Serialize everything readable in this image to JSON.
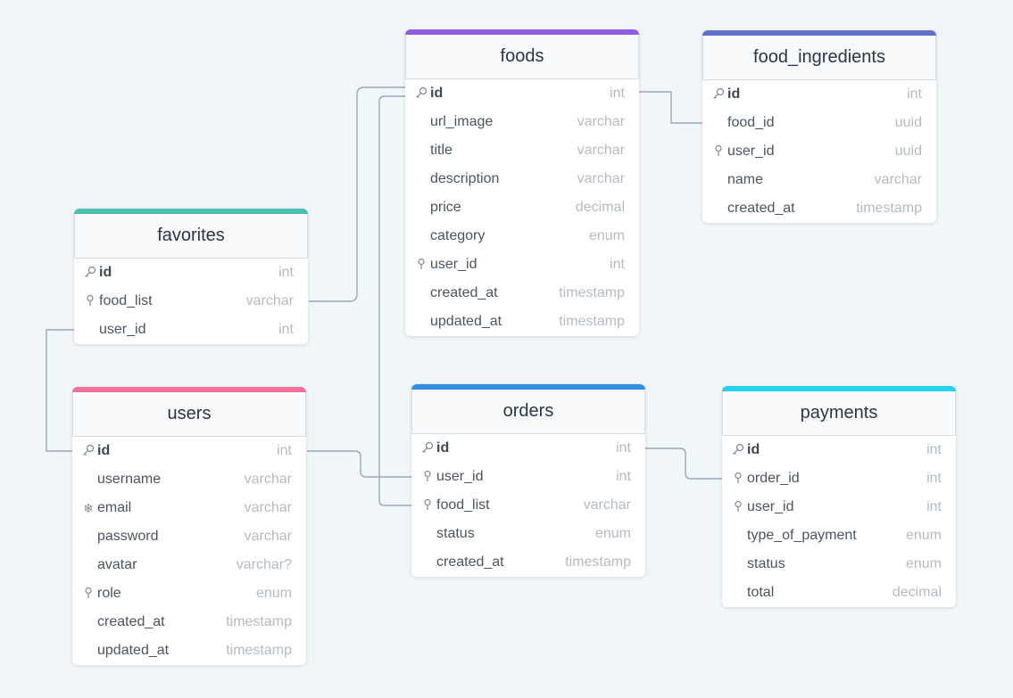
{
  "tables": [
    {
      "name": "foods",
      "color": "#8e5ee0",
      "fields": [
        {
          "name": "id",
          "type": "int",
          "icon": "key-icon",
          "pk": true
        },
        {
          "name": "url_image",
          "type": "varchar",
          "icon": ""
        },
        {
          "name": "title",
          "type": "varchar",
          "icon": ""
        },
        {
          "name": "description",
          "type": "varchar",
          "icon": ""
        },
        {
          "name": "price",
          "type": "decimal",
          "icon": ""
        },
        {
          "name": "category",
          "type": "enum",
          "icon": ""
        },
        {
          "name": "user_id",
          "type": "int",
          "icon": "index-pin-icon"
        },
        {
          "name": "created_at",
          "type": "timestamp",
          "icon": ""
        },
        {
          "name": "updated_at",
          "type": "timestamp",
          "icon": ""
        }
      ]
    },
    {
      "name": "food_ingredients",
      "color": "#6370c9",
      "fields": [
        {
          "name": "id",
          "type": "int",
          "icon": "key-icon",
          "pk": true
        },
        {
          "name": "food_id",
          "type": "uuid",
          "icon": ""
        },
        {
          "name": "user_id",
          "type": "uuid",
          "icon": "index-pin-icon"
        },
        {
          "name": "name",
          "type": "varchar",
          "icon": ""
        },
        {
          "name": "created_at",
          "type": "timestamp",
          "icon": ""
        }
      ]
    },
    {
      "name": "favorites",
      "color": "#4dbfb0",
      "fields": [
        {
          "name": "id",
          "type": "int",
          "icon": "key-icon",
          "pk": true
        },
        {
          "name": "food_list",
          "type": "varchar",
          "icon": "index-pin-icon"
        },
        {
          "name": "user_id",
          "type": "int",
          "icon": ""
        }
      ]
    },
    {
      "name": "users",
      "color": "#f06f9b",
      "fields": [
        {
          "name": "id",
          "type": "int",
          "icon": "key-icon",
          "pk": true
        },
        {
          "name": "username",
          "type": "varchar",
          "icon": ""
        },
        {
          "name": "email",
          "type": "varchar",
          "icon": "unique-snowflake-icon"
        },
        {
          "name": "password",
          "type": "varchar",
          "icon": ""
        },
        {
          "name": "avatar",
          "type": "varchar?",
          "icon": ""
        },
        {
          "name": "role",
          "type": "enum",
          "icon": "index-pin-icon"
        },
        {
          "name": "created_at",
          "type": "timestamp",
          "icon": ""
        },
        {
          "name": "updated_at",
          "type": "timestamp",
          "icon": ""
        }
      ]
    },
    {
      "name": "orders",
      "color": "#2f8fe0",
      "fields": [
        {
          "name": "id",
          "type": "int",
          "icon": "key-icon",
          "pk": true
        },
        {
          "name": "user_id",
          "type": "int",
          "icon": "index-pin-icon"
        },
        {
          "name": "food_list",
          "type": "varchar",
          "icon": "index-pin-icon"
        },
        {
          "name": "status",
          "type": "enum",
          "icon": ""
        },
        {
          "name": "created_at",
          "type": "timestamp",
          "icon": ""
        }
      ]
    },
    {
      "name": "payments",
      "color": "#26d3ee",
      "fields": [
        {
          "name": "id",
          "type": "int",
          "icon": "key-icon",
          "pk": true
        },
        {
          "name": "order_id",
          "type": "int",
          "icon": "index-pin-icon"
        },
        {
          "name": "user_id",
          "type": "int",
          "icon": "index-pin-icon"
        },
        {
          "name": "type_of_payment",
          "type": "enum",
          "icon": ""
        },
        {
          "name": "status",
          "type": "enum",
          "icon": ""
        },
        {
          "name": "total",
          "type": "decimal",
          "icon": ""
        }
      ]
    }
  ],
  "relations": [
    {
      "from": "favorites.food_list",
      "to": "foods.id"
    },
    {
      "from": "foods.id",
      "to": "food_ingredients.food_id"
    },
    {
      "from": "favorites.user_id",
      "to": "users.id"
    },
    {
      "from": "users.id",
      "to": "orders.user_id"
    },
    {
      "from": "orders.food_list",
      "to": "foods.id"
    },
    {
      "from": "orders.id",
      "to": "payments.order_id"
    }
  ]
}
